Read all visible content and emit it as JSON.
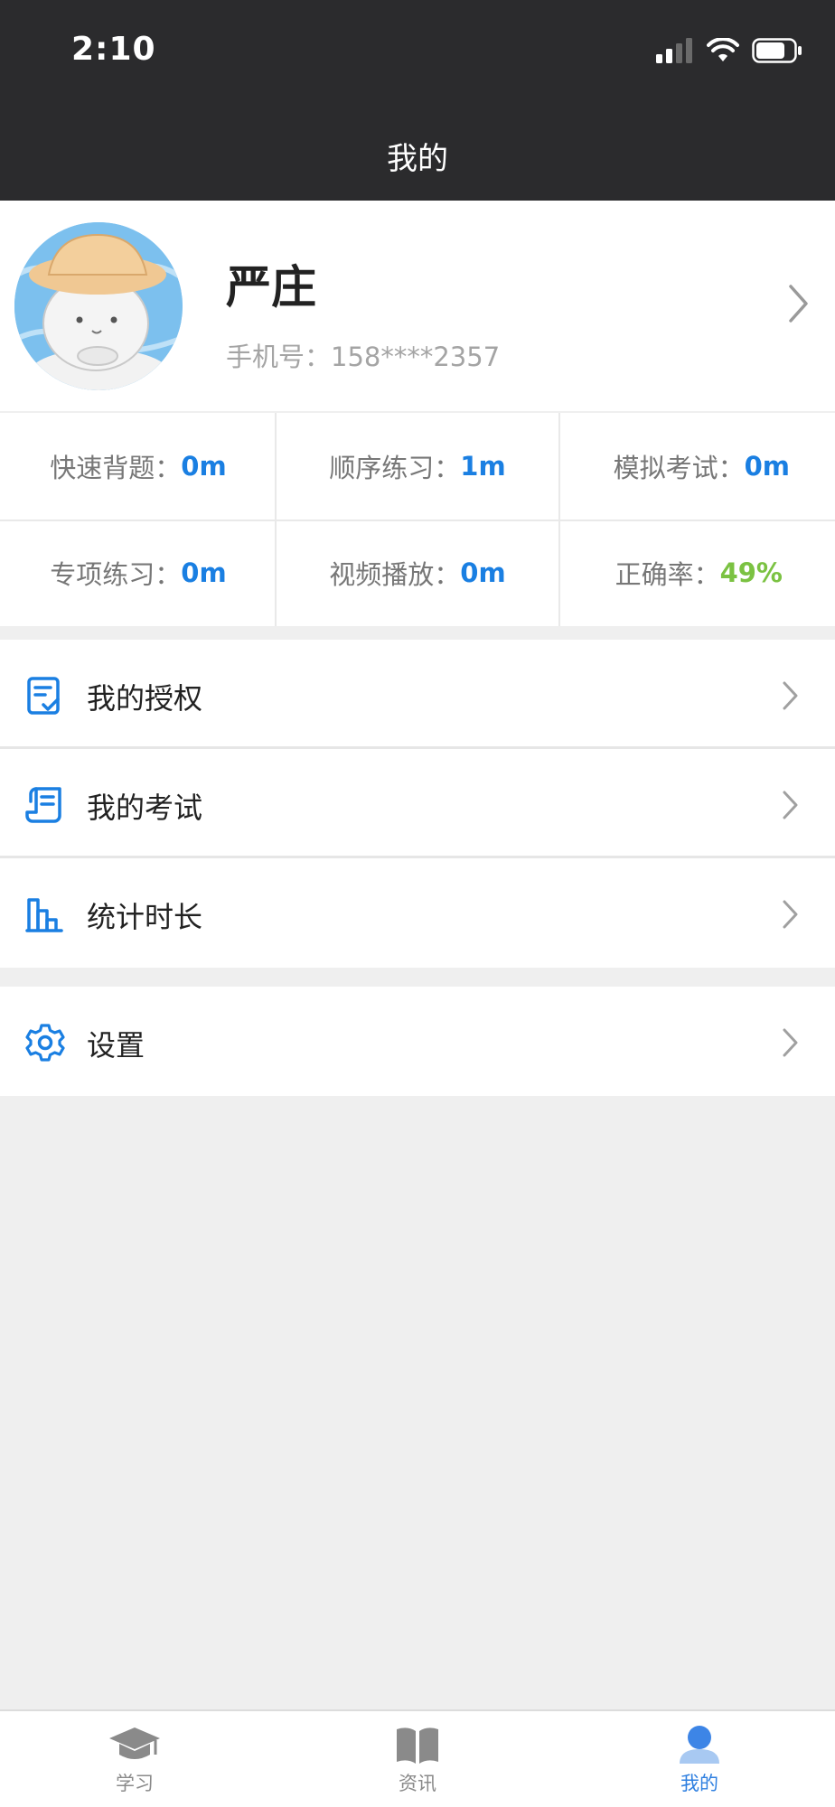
{
  "status_bar": {
    "time": "2:10"
  },
  "header": {
    "title": "我的"
  },
  "profile": {
    "name": "严庄",
    "phone": "手机号：158****2357"
  },
  "stats": [
    {
      "label": "快速背题：",
      "value": "0m"
    },
    {
      "label": "顺序练习：",
      "value": "1m"
    },
    {
      "label": "模拟考试：",
      "value": "0m"
    },
    {
      "label": "专项练习：",
      "value": "0m"
    },
    {
      "label": "视频播放：",
      "value": "0m"
    },
    {
      "label": "正确率：",
      "value": "49%"
    }
  ],
  "menu": [
    {
      "label": "我的授权",
      "icon": "authorization-icon"
    },
    {
      "label": "我的考试",
      "icon": "exam-icon"
    },
    {
      "label": "统计时长",
      "icon": "statistics-icon"
    }
  ],
  "settings": {
    "label": "设置",
    "icon": "gear-icon"
  },
  "tabbar": [
    {
      "label": "学习",
      "icon": "graduation-cap-icon"
    },
    {
      "label": "资讯",
      "icon": "book-icon"
    },
    {
      "label": "我的",
      "icon": "user-icon",
      "active": true
    }
  ],
  "colors": {
    "accent": "#1a7fe2",
    "success": "#7bc242",
    "header_bg": "#2b2b2d"
  }
}
